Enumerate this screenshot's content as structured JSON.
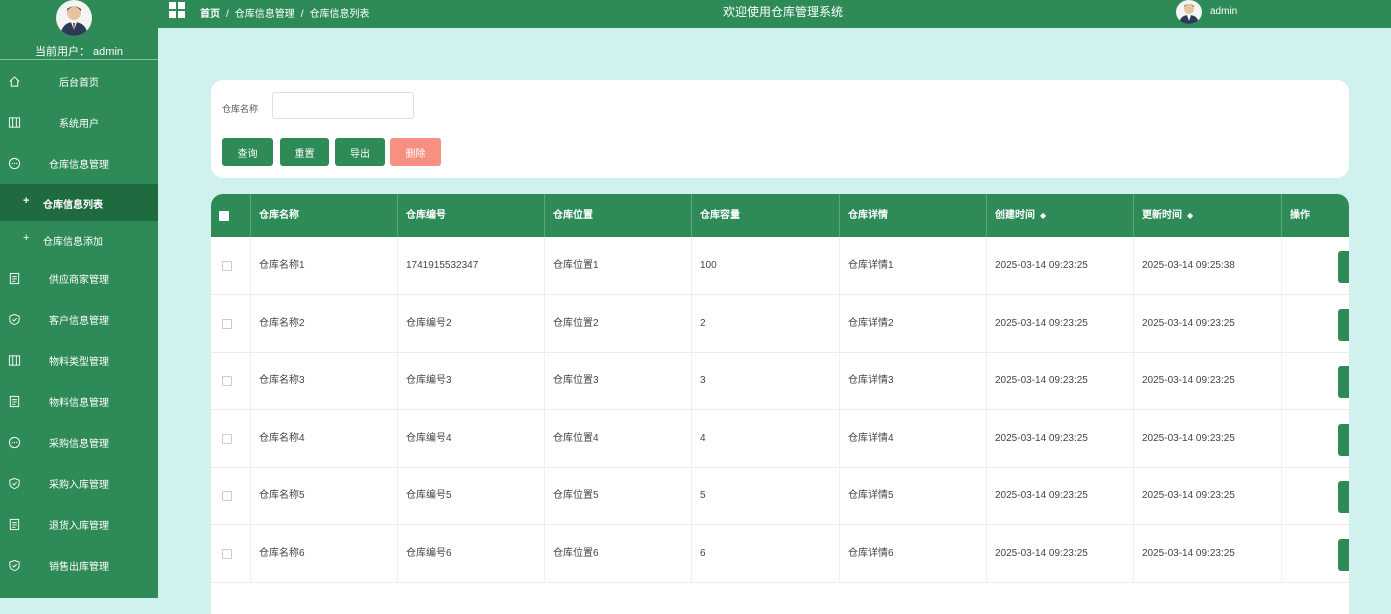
{
  "sidebar": {
    "current_user_label": "当前用户：",
    "current_user": "admin",
    "items": [
      {
        "label": "后台首页",
        "icon": "home-icon"
      },
      {
        "label": "系统用户",
        "icon": "columns-icon"
      },
      {
        "label": "仓库信息管理",
        "icon": "chat-icon"
      },
      {
        "label": "供应商家管理",
        "icon": "document-icon"
      },
      {
        "label": "客户信息管理",
        "icon": "shield-icon"
      },
      {
        "label": "物料类型管理",
        "icon": "columns-icon"
      },
      {
        "label": "物料信息管理",
        "icon": "document-icon"
      },
      {
        "label": "采购信息管理",
        "icon": "chat-icon"
      },
      {
        "label": "采购入库管理",
        "icon": "shield-icon"
      },
      {
        "label": "退货入库管理",
        "icon": "document-icon"
      },
      {
        "label": "销售出库管理",
        "icon": "shield-icon"
      }
    ],
    "sub_items": [
      {
        "label": "仓库信息列表"
      },
      {
        "label": "仓库信息添加"
      }
    ]
  },
  "header": {
    "breadcrumb": [
      "首页",
      "仓库信息管理",
      "仓库信息列表"
    ],
    "welcome": "欢迎使用仓库管理系统",
    "user": "admin"
  },
  "search": {
    "label": "仓库名称",
    "value": "",
    "buttons": {
      "query": "查询",
      "reset": "重置",
      "export": "导出",
      "delete": "删除"
    }
  },
  "table": {
    "columns": [
      "仓库名称",
      "仓库编号",
      "仓库位置",
      "仓库容量",
      "仓库详情",
      "创建时间",
      "更新时间",
      "操作"
    ],
    "rows": [
      [
        "仓库名称1",
        "1741915532347",
        "仓库位置1",
        "100",
        "仓库详情1",
        "2025-03-14 09:23:25",
        "2025-03-14 09:25:38"
      ],
      [
        "仓库名称2",
        "仓库编号2",
        "仓库位置2",
        "2",
        "仓库详情2",
        "2025-03-14 09:23:25",
        "2025-03-14 09:23:25"
      ],
      [
        "仓库名称3",
        "仓库编号3",
        "仓库位置3",
        "3",
        "仓库详情3",
        "2025-03-14 09:23:25",
        "2025-03-14 09:23:25"
      ],
      [
        "仓库名称4",
        "仓库编号4",
        "仓库位置4",
        "4",
        "仓库详情4",
        "2025-03-14 09:23:25",
        "2025-03-14 09:23:25"
      ],
      [
        "仓库名称5",
        "仓库编号5",
        "仓库位置5",
        "5",
        "仓库详情5",
        "2025-03-14 09:23:25",
        "2025-03-14 09:23:25"
      ],
      [
        "仓库名称6",
        "仓库编号6",
        "仓库位置6",
        "6",
        "仓库详情6",
        "2025-03-14 09:23:25",
        "2025-03-14 09:23:25"
      ]
    ]
  },
  "colors": {
    "primary": "#2e8b57",
    "danger": "#f78f82",
    "background": "#d0f1ee"
  }
}
